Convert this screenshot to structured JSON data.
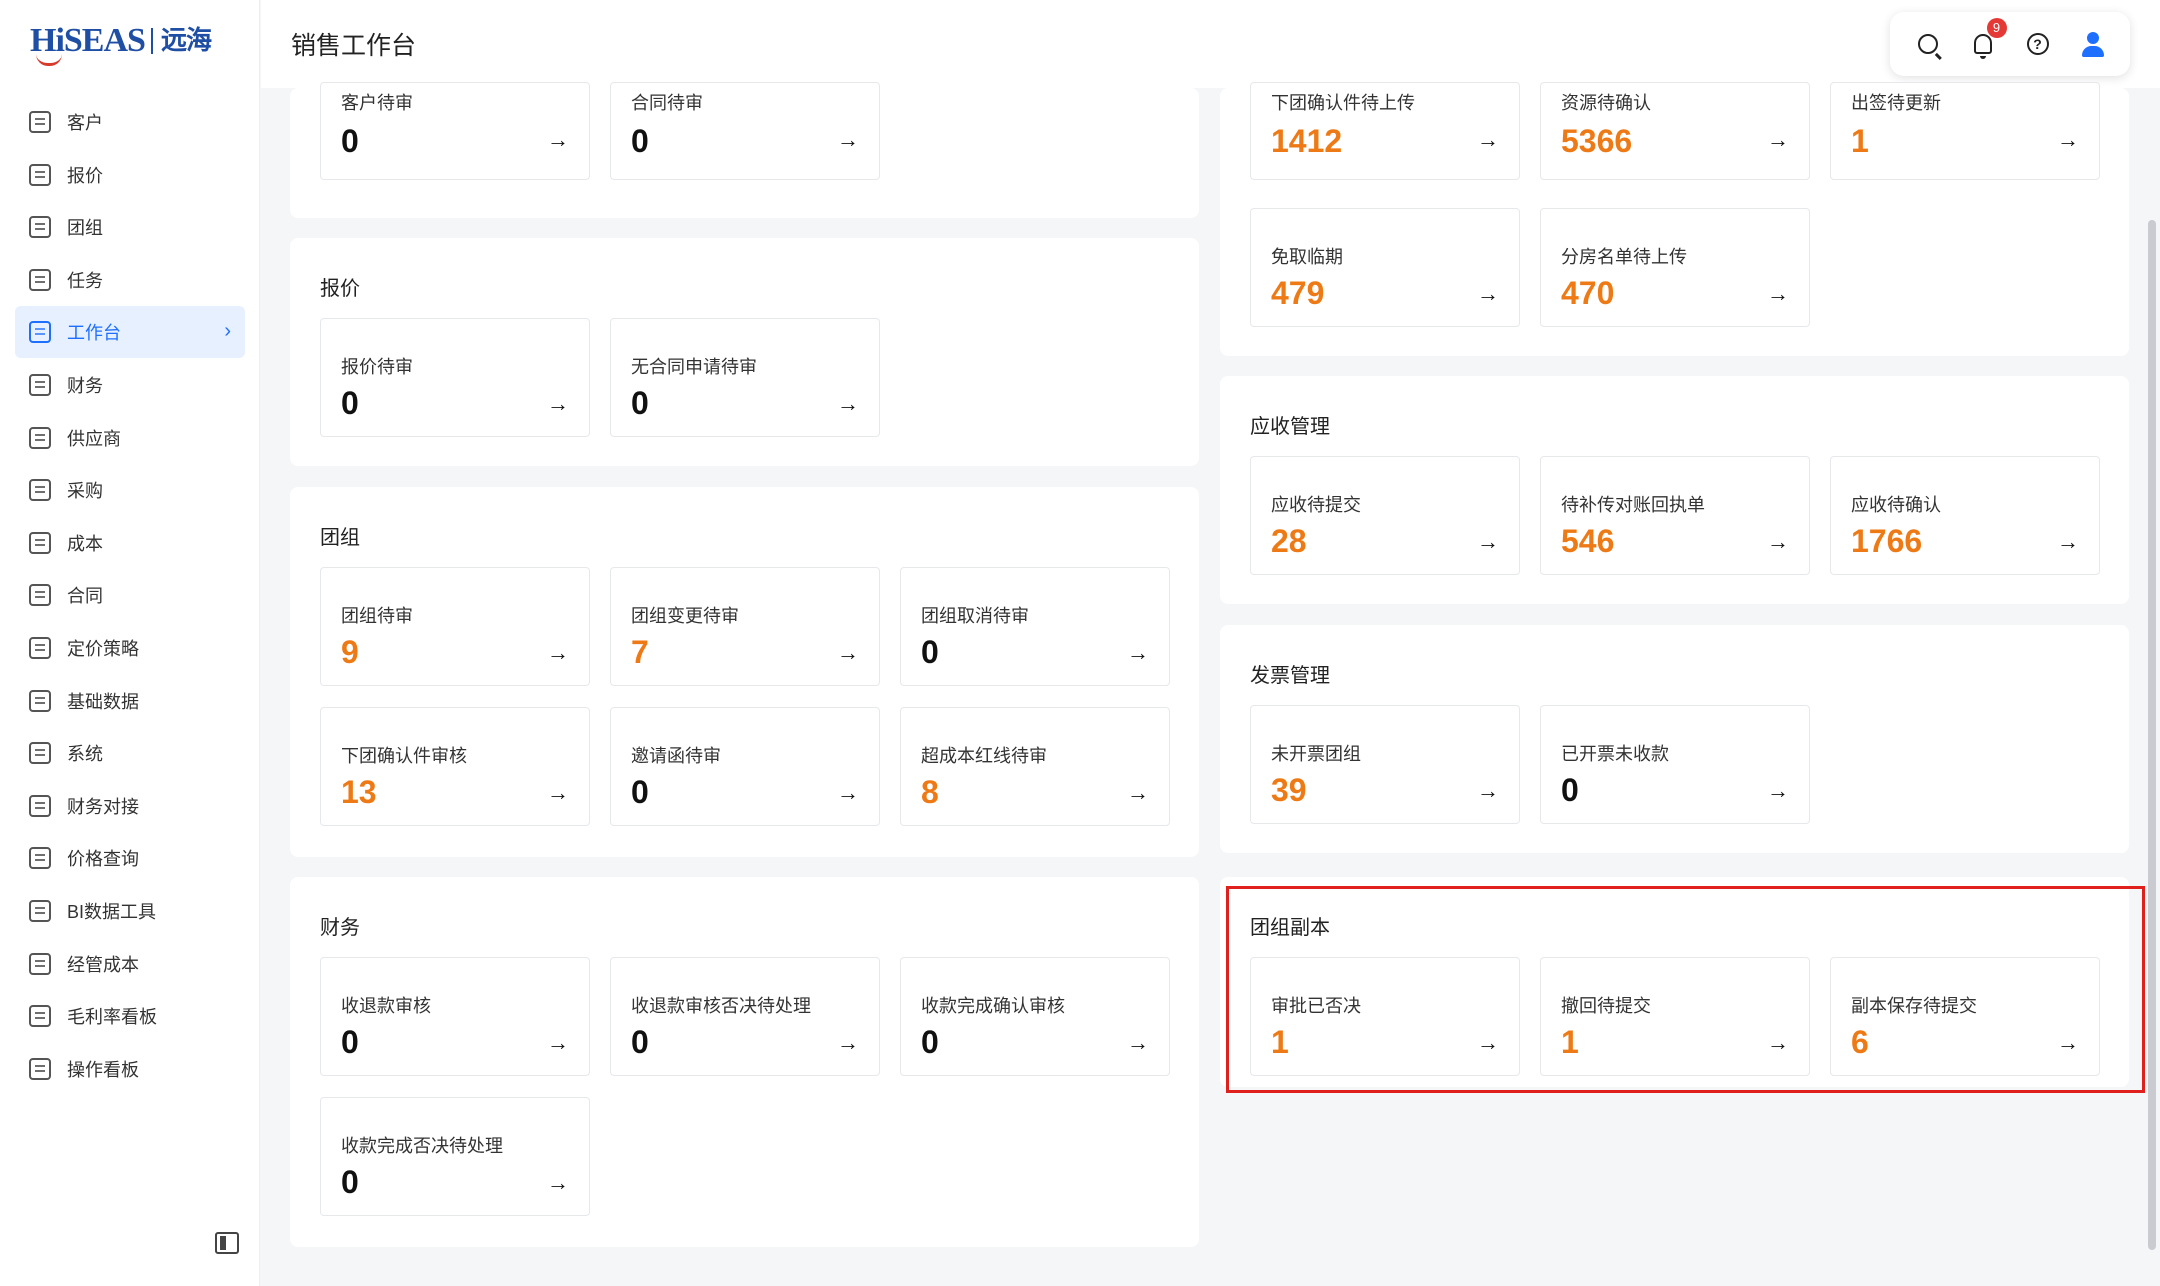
{
  "brand": {
    "logo_en": "HiSEAS",
    "logo_cn": "远海"
  },
  "header": {
    "title": "销售工作台",
    "notification_count": "9",
    "help_symbol": "?"
  },
  "sidebar": {
    "items": [
      {
        "label": "客户",
        "icon": "customer-icon"
      },
      {
        "label": "报价",
        "icon": "quote-icon"
      },
      {
        "label": "团组",
        "icon": "group-icon"
      },
      {
        "label": "任务",
        "icon": "task-icon"
      },
      {
        "label": "工作台",
        "icon": "dashboard-icon",
        "active": true
      },
      {
        "label": "财务",
        "icon": "finance-icon"
      },
      {
        "label": "供应商",
        "icon": "supplier-icon"
      },
      {
        "label": "采购",
        "icon": "purchase-icon"
      },
      {
        "label": "成本",
        "icon": "cost-icon"
      },
      {
        "label": "合同",
        "icon": "contract-icon"
      },
      {
        "label": "定价策略",
        "icon": "pricing-icon"
      },
      {
        "label": "基础数据",
        "icon": "base-data-icon"
      },
      {
        "label": "系统",
        "icon": "system-icon"
      },
      {
        "label": "财务对接",
        "icon": "finance-link-icon"
      },
      {
        "label": "价格查询",
        "icon": "price-search-icon"
      },
      {
        "label": "BI数据工具",
        "icon": "bi-icon"
      },
      {
        "label": "经管成本",
        "icon": "management-cost-icon"
      },
      {
        "label": "毛利率看板",
        "icon": "margin-board-icon"
      },
      {
        "label": "操作看板",
        "icon": "operation-board-icon"
      }
    ],
    "active_chevron": "›"
  },
  "sections": {
    "contract_top": {
      "cards": [
        {
          "label": "客户待审",
          "value": "0"
        },
        {
          "label": "合同待审",
          "value": "0"
        }
      ]
    },
    "quote": {
      "title": "报价",
      "cards": [
        {
          "label": "报价待审",
          "value": "0"
        },
        {
          "label": "无合同申请待审",
          "value": "0"
        }
      ]
    },
    "group": {
      "title": "团组",
      "cards": [
        {
          "label": "团组待审",
          "value": "9"
        },
        {
          "label": "团组变更待审",
          "value": "7"
        },
        {
          "label": "团组取消待审",
          "value": "0"
        },
        {
          "label": "下团确认件审核",
          "value": "13"
        },
        {
          "label": "邀请函待审",
          "value": "0"
        },
        {
          "label": "超成本红线待审",
          "value": "8"
        }
      ]
    },
    "finance": {
      "title": "财务",
      "cards": [
        {
          "label": "收退款审核",
          "value": "0"
        },
        {
          "label": "收退款审核否决待处理",
          "value": "0"
        },
        {
          "label": "收款完成确认审核",
          "value": "0"
        },
        {
          "label": "收款完成否决待处理",
          "value": "0"
        }
      ]
    },
    "ops_top": {
      "cards": [
        {
          "label": "下团确认件待上传",
          "value": "1412"
        },
        {
          "label": "资源待确认",
          "value": "5366"
        },
        {
          "label": "出签待更新",
          "value": "1"
        },
        {
          "label": "免取临期",
          "value": "479"
        },
        {
          "label": "分房名单待上传",
          "value": "470"
        }
      ]
    },
    "receivable": {
      "title": "应收管理",
      "cards": [
        {
          "label": "应收待提交",
          "value": "28"
        },
        {
          "label": "待补传对账回执单",
          "value": "546"
        },
        {
          "label": "应收待确认",
          "value": "1766"
        }
      ]
    },
    "invoice": {
      "title": "发票管理",
      "cards": [
        {
          "label": "未开票团组",
          "value": "39"
        },
        {
          "label": "已开票未收款",
          "value": "0"
        }
      ]
    },
    "copy": {
      "title": "团组副本",
      "cards": [
        {
          "label": "审批已否决",
          "value": "1"
        },
        {
          "label": "撤回待提交",
          "value": "1"
        },
        {
          "label": "副本保存待提交",
          "value": "6"
        }
      ]
    }
  },
  "arrow": "→",
  "colors": {
    "accent": "#1f6fff",
    "value_highlight": "#ee7a16",
    "highlight_box": "#e0201c"
  }
}
